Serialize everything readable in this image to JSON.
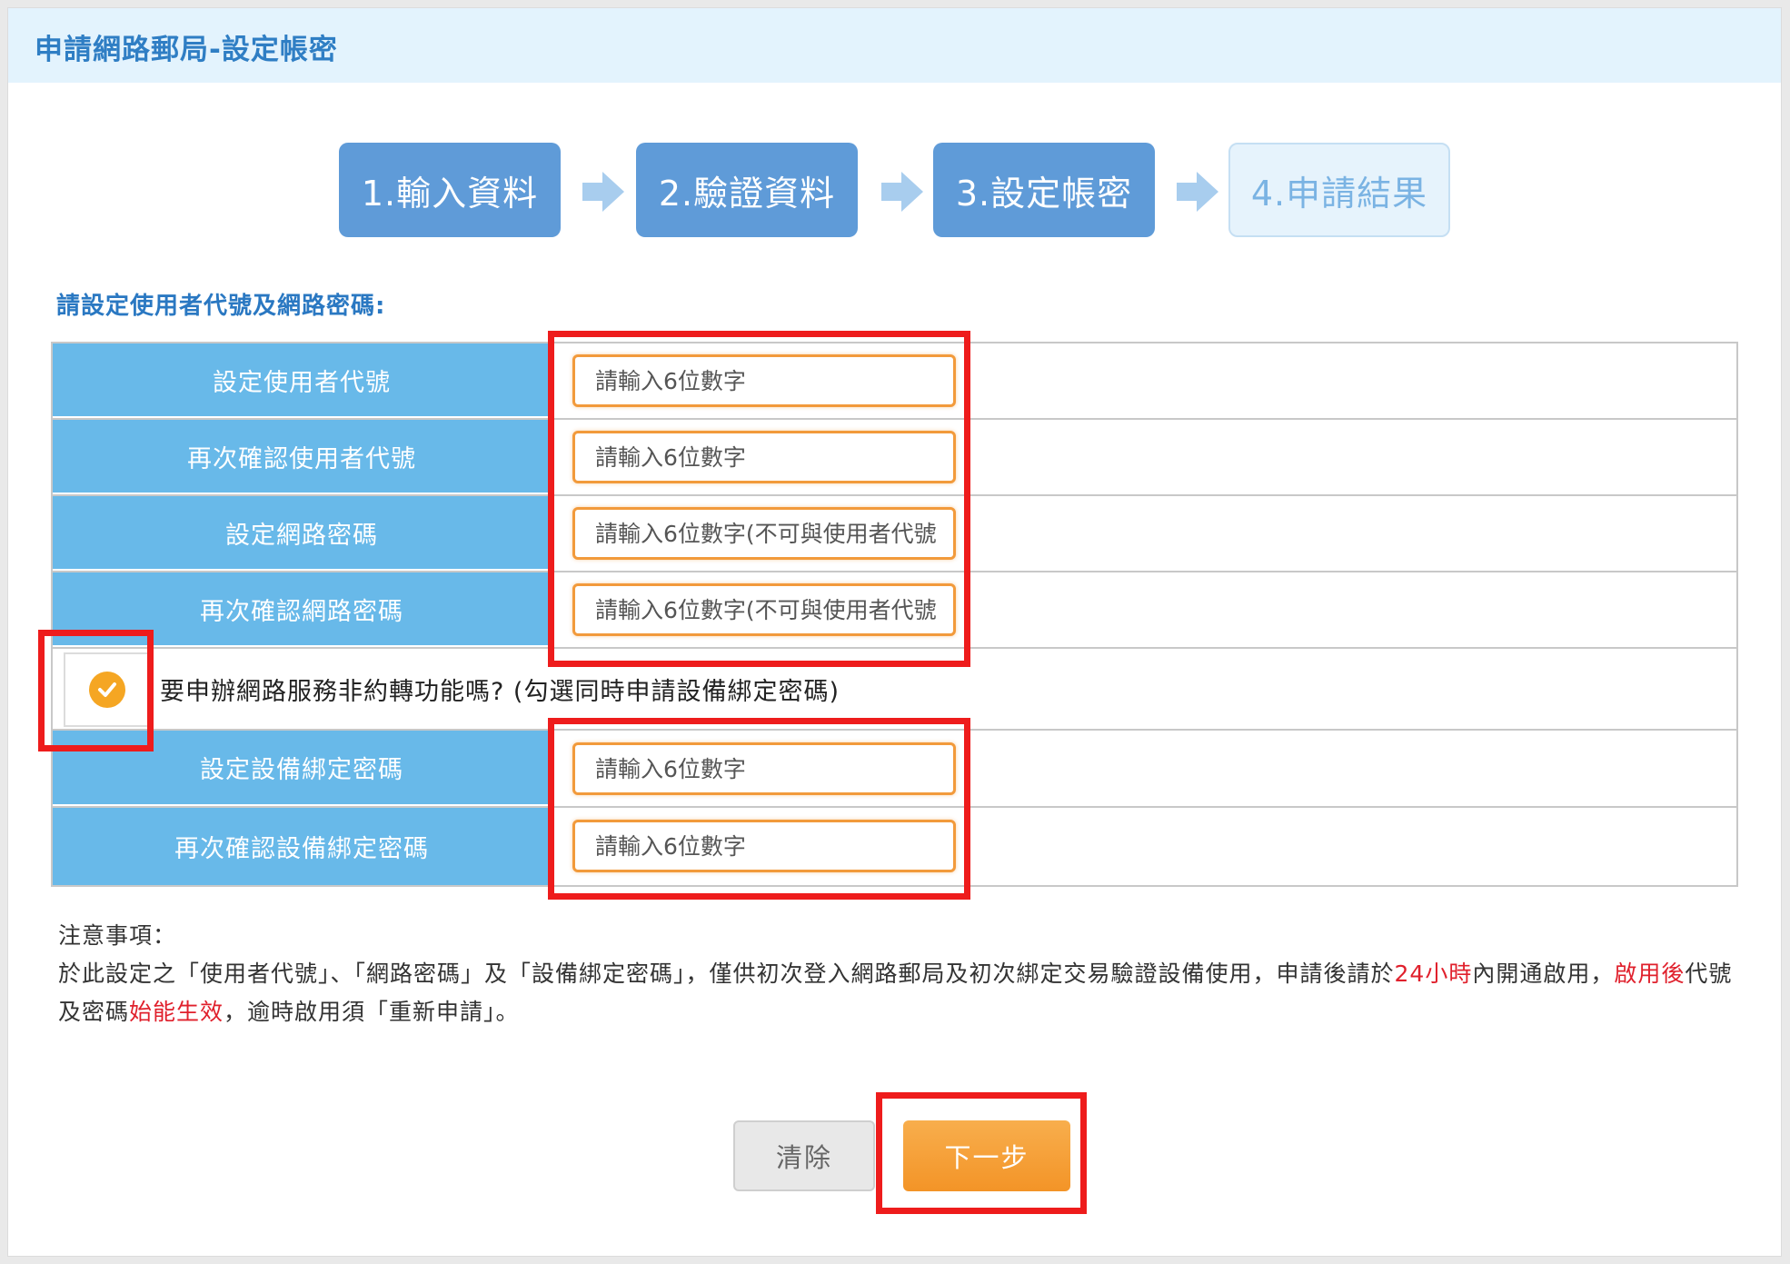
{
  "header": {
    "title": "申請網路郵局-設定帳密"
  },
  "steps": [
    {
      "label": "1.輸入資料",
      "state": "done"
    },
    {
      "label": "2.驗證資料",
      "state": "done"
    },
    {
      "label": "3.設定帳密",
      "state": "current"
    },
    {
      "label": "4.申請結果",
      "state": "pending"
    }
  ],
  "form": {
    "section_title": "請設定使用者代號及網路密碼:",
    "rows": [
      {
        "label": "設定使用者代號",
        "placeholder": "請輸入6位數字"
      },
      {
        "label": "再次確認使用者代號",
        "placeholder": "請輸入6位數字"
      },
      {
        "label": "設定網路密碼",
        "placeholder": "請輸入6位數字(不可與使用者代號"
      },
      {
        "label": "再次確認網路密碼",
        "placeholder": "請輸入6位數字(不可與使用者代號"
      }
    ],
    "non_agreed_transfer": {
      "checked": true,
      "label": "要申辦網路服務非約轉功能嗎? (勾選同時申請設備綁定密碼)"
    },
    "device_rows": [
      {
        "label": "設定設備綁定密碼",
        "placeholder": "請輸入6位數字"
      },
      {
        "label": "再次確認設備綁定密碼",
        "placeholder": "請輸入6位數字"
      }
    ]
  },
  "notice": {
    "title": "注意事項：",
    "text_1": "於此設定之「使用者代號」、「網路密碼」及「設備綁定密碼」，僅供初次登入網路郵局及初次綁定交易驗證設備使用，申請後請於",
    "highlight_1": "24小時",
    "text_2": "內開通啟用，",
    "highlight_2": "啟用後",
    "text_3": "代號及密碼",
    "highlight_3": "始能生效",
    "text_4": "，逾時啟用須「重新申請」。"
  },
  "buttons": {
    "clear": "清除",
    "next": "下一步"
  },
  "colors": {
    "header_bg": "#e3f3fd",
    "title": "#2f7ec4",
    "step_done": "#5f9bd8",
    "label_bg": "#68b9e9",
    "input_border": "#f29a3b",
    "highlight_frame": "#ee1c1c",
    "next_button": "#f7a13b",
    "alert_text": "#e0202c"
  }
}
